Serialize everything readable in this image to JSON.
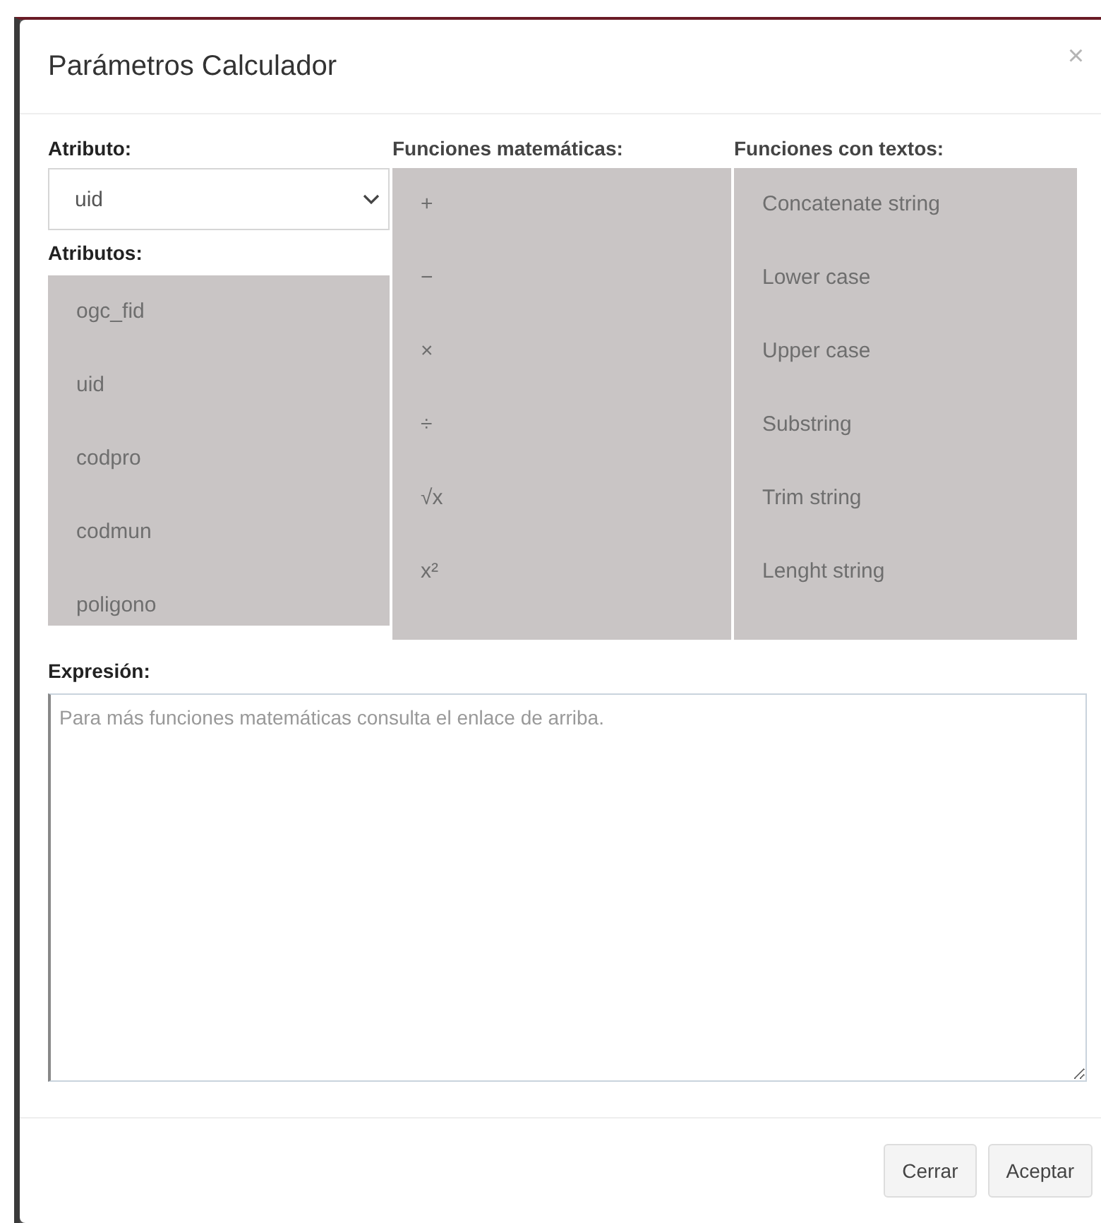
{
  "dialog": {
    "title": "Parámetros Calculador",
    "close": "×"
  },
  "attribute_select": {
    "label": "Atributo:",
    "value": "uid"
  },
  "attributes": {
    "label": "Atributos:",
    "items": [
      "ogc_fid",
      "uid",
      "codpro",
      "codmun",
      "poligono"
    ]
  },
  "math_functions": {
    "label": "Funciones matemáticas:",
    "items": [
      "+",
      "−",
      "×",
      "÷",
      "√x",
      "x²"
    ]
  },
  "text_functions": {
    "label": "Funciones con textos:",
    "items": [
      "Concatenate string",
      "Lower case",
      "Upper case",
      "Substring",
      "Trim string",
      "Lenght string"
    ]
  },
  "expression": {
    "label": "Expresión:",
    "placeholder": "Para más funciones matemáticas consulta el enlace de arriba."
  },
  "buttons": [
    "Cerrar",
    "Aceptar"
  ]
}
